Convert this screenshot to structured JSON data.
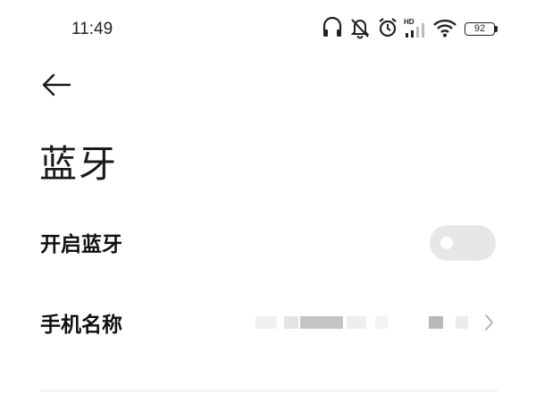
{
  "status_bar": {
    "time": "11:49",
    "battery_level": "92",
    "network_label": "HD",
    "icons": [
      "headphones-icon",
      "muted-bell-icon",
      "alarm-icon",
      "hd-signal-icon",
      "wifi-icon",
      "battery-icon"
    ]
  },
  "header": {
    "back_icon": "arrow-left-icon",
    "title": "蓝牙"
  },
  "settings": {
    "bluetooth_toggle": {
      "label": "开启蓝牙",
      "enabled": false
    },
    "device_name": {
      "label": "手机名称",
      "value": "",
      "chevron_icon": "chevron-right-icon"
    }
  },
  "colors": {
    "background": "#ffffff",
    "text": "#1a1a1a",
    "toggle_track_off": "#e7e7e7",
    "divider": "#e6e6e6"
  }
}
